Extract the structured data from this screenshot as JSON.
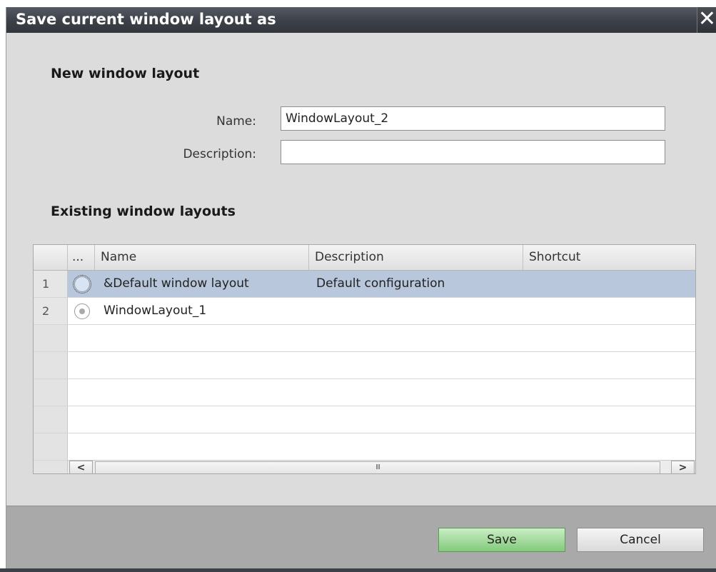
{
  "dialog": {
    "title": "Save current window layout as",
    "close_icon": "close-icon"
  },
  "new_layout": {
    "heading": "New window layout",
    "name_label": "Name:",
    "name_value": "WindowLayout_2",
    "description_label": "Description:",
    "description_value": ""
  },
  "existing_layouts": {
    "heading": "Existing window layouts",
    "columns": [
      "...",
      "Name",
      "Description",
      "Shortcut"
    ],
    "rows": [
      {
        "num": "1",
        "name": "&Default window layout",
        "description": "Default configuration",
        "shortcut": "",
        "selected": true
      },
      {
        "num": "2",
        "name": "WindowLayout_1",
        "description": "",
        "shortcut": "",
        "selected": false
      }
    ],
    "scroll_left": "<",
    "scroll_right": ">",
    "scroll_thumb_grip": "III"
  },
  "buttons": {
    "save_label": "Save",
    "cancel_label": "Cancel"
  },
  "colors": {
    "title_bar": "#3c4048",
    "selected_row": "#b8c7dc",
    "save_button": "#83c97b"
  }
}
